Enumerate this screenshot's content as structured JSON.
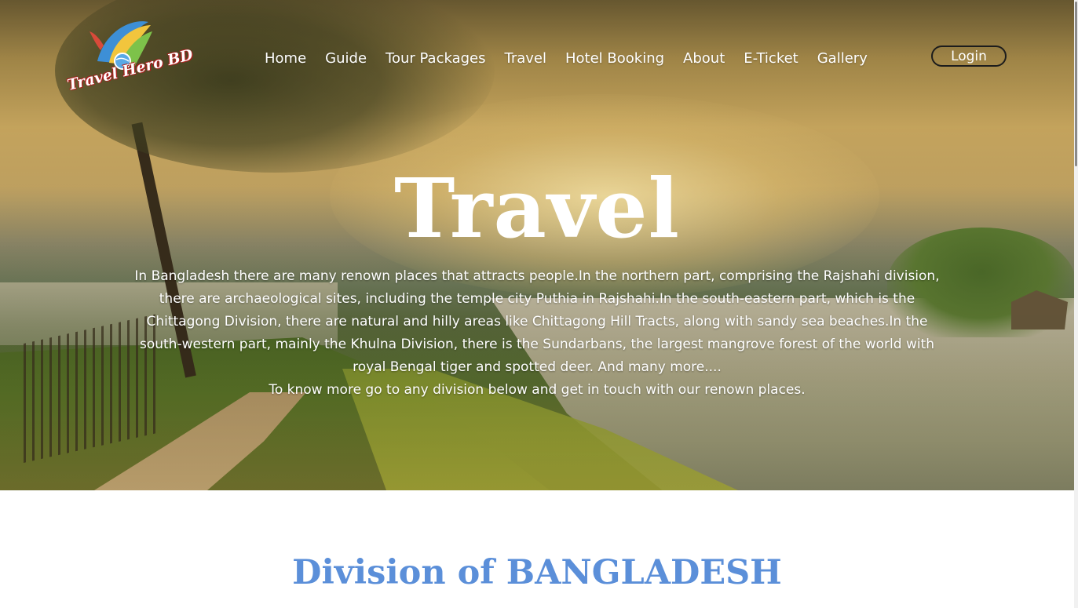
{
  "logo": {
    "text": "Travel Hero BD"
  },
  "nav": {
    "items": [
      {
        "label": "Home"
      },
      {
        "label": "Guide"
      },
      {
        "label": "Tour Packages"
      },
      {
        "label": "Travel"
      },
      {
        "label": "Hotel Booking"
      },
      {
        "label": "About"
      },
      {
        "label": "E-Ticket"
      },
      {
        "label": "Gallery"
      }
    ],
    "login_label": "Login"
  },
  "hero": {
    "title": "Travel",
    "description": "In Bangladesh there are many renown places that attracts people.In the northern part, comprising the Rajshahi division, there are archaeological sites, including the temple city Puthia in Rajshahi.In the south-eastern part, which is the Chittagong Division, there are natural and hilly areas like Chittagong Hill Tracts, along with sandy sea beaches.In the south-western part, mainly the Khulna Division, there is the Sundarbans, the largest mangrove forest of the world with royal Bengal tiger and spotted deer. And many more....",
    "cta_text": "To know more go to any division below and get in touch with our renown places."
  },
  "section": {
    "title": "Division of BANGLADESH"
  },
  "colors": {
    "section_title": "#5b8fd9",
    "nav_text": "#ffffff",
    "login_border": "#1c1c1c"
  }
}
